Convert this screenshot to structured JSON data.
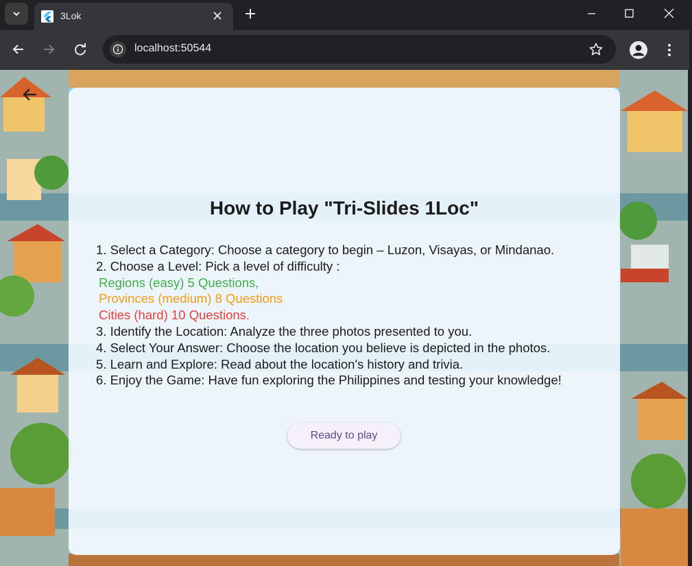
{
  "browser": {
    "tab_title": "3Lok",
    "url": "localhost:50544"
  },
  "page": {
    "title": "How to Play \"Tri-Slides 1Loc\"",
    "steps": [
      "1. Select a Category: Choose a category to begin – Luzon, Visayas, or Mindanao.",
      "2. Choose a Level: Pick a level of difficulty :",
      "3. Identify the Location: Analyze the three photos presented to you.",
      "4. Select Your Answer: Choose the location you believe is depicted in the photos.",
      "5. Learn and Explore: Read about the location's history and trivia.",
      "6. Enjoy the Game: Have fun exploring the Philippines and testing your knowledge!"
    ],
    "levels": [
      {
        "label": "Regions (easy) 5 Questions,",
        "color": "#3fae49"
      },
      {
        "label": "Provinces (medium) 8 Questions",
        "color": "#f39a14"
      },
      {
        "label": "Cities (hard) 10 Questions.",
        "color": "#e5403a"
      }
    ],
    "ready_label": "Ready to play"
  },
  "icons": {
    "back": "arrow-left-icon",
    "info": "info-icon",
    "star": "star-outline-icon",
    "profile": "account-circle-icon",
    "menu": "more-vert-icon"
  },
  "colors": {
    "accent": "#5b4a8e",
    "chrome_dark": "#202124",
    "chrome_toolbar": "#35363a"
  }
}
